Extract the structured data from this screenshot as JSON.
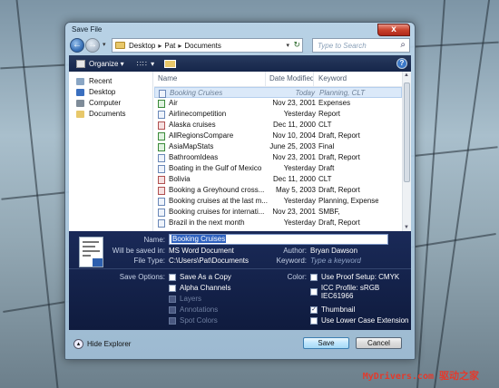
{
  "window": {
    "title": "Save File",
    "close_glyph": "x"
  },
  "nav": {
    "back_glyph": "←",
    "forward_glyph": "→",
    "dropdown_glyph": "▾",
    "breadcrumb": [
      "Desktop",
      "Pat",
      "Documents"
    ],
    "crumb_sep": "▸",
    "refresh_glyph": "↻",
    "search_placeholder": "Type to Search",
    "search_glyph": "⌕"
  },
  "toolbar": {
    "organize_label": "Organize ▾",
    "views_glyph": "∷∷ ▾",
    "help_glyph": "?"
  },
  "sidebar": {
    "items": [
      {
        "label": "Recent",
        "icon": "recent-icon",
        "color": "#8aa6c4"
      },
      {
        "label": "Desktop",
        "icon": "desktop-icon",
        "color": "#3a6fbf"
      },
      {
        "label": "Computer",
        "icon": "computer-icon",
        "color": "#7f8c99"
      },
      {
        "label": "Documents",
        "icon": "documents-folder-icon",
        "color": "#e8c86a"
      }
    ]
  },
  "files": {
    "columns": {
      "name": "Name",
      "date": "Date Modified",
      "keyword": "Keyword"
    },
    "rows": [
      {
        "name": "Booking Cruises",
        "date": "Today",
        "keyword": "Planning, CLT",
        "type": "doc",
        "selected": true
      },
      {
        "name": "Air",
        "date": "Nov 23, 2001",
        "keyword": "Expenses",
        "type": "xls"
      },
      {
        "name": "Airlinecompetition",
        "date": "Yesterday",
        "keyword": "Report",
        "type": "doc"
      },
      {
        "name": "Alaska cruises",
        "date": "Dec 11, 2000",
        "keyword": "CLT",
        "type": "jpg"
      },
      {
        "name": "AllRegionsCompare",
        "date": "Nov 10, 2004",
        "keyword": "Draft, Report",
        "type": "xls"
      },
      {
        "name": "AsiaMapStats",
        "date": "June 25, 2003",
        "keyword": "Final",
        "type": "xls"
      },
      {
        "name": "BathroomIdeas",
        "date": "Nov 23, 2001",
        "keyword": "Draft, Report",
        "type": "doc"
      },
      {
        "name": "Boating in the Gulf of Mexico",
        "date": "Yesterday",
        "keyword": "Draft",
        "type": "doc"
      },
      {
        "name": "Bolivia",
        "date": "Dec 11, 2000",
        "keyword": "CLT",
        "type": "jpg"
      },
      {
        "name": "Booking a Greyhound cross...",
        "date": "May 5, 2003",
        "keyword": "Draft, Report",
        "type": "jpg"
      },
      {
        "name": "Booking cruises at the last m...",
        "date": "Yesterday",
        "keyword": "Planning, Expenses...",
        "type": "doc"
      },
      {
        "name": "Booking cruises for internati...",
        "date": "Nov 23, 2001",
        "keyword": "SMBF,",
        "type": "doc"
      },
      {
        "name": "Brazil in the next month",
        "date": "Yesterday",
        "keyword": "Draft, Report",
        "type": "doc"
      }
    ]
  },
  "details": {
    "name_label": "Name:",
    "name_value": "Booking Cruises",
    "saved_in_label": "Will be saved in:",
    "saved_in_value": "MS Word Document",
    "filetype_label": "File Type:",
    "filetype_value": "C:\\Users\\Pat\\Documents",
    "author_label": "Author:",
    "author_value": "Bryan Dawson",
    "keyword_label": "Keyword:",
    "keyword_placeholder": "Type a keyword",
    "save_options_label": "Save Options:",
    "color_label": "Color:",
    "options_left": [
      {
        "label": "Save As a Copy",
        "checked": false,
        "enabled": true
      },
      {
        "label": "Alpha Channels",
        "checked": false,
        "enabled": true
      },
      {
        "label": "Layers",
        "checked": false,
        "enabled": false
      },
      {
        "label": "Annotations",
        "checked": false,
        "enabled": false
      },
      {
        "label": "Spot Colors",
        "checked": false,
        "enabled": false
      }
    ],
    "options_right": [
      {
        "label": "Use Proof Setup: CMYK",
        "checked": false
      },
      {
        "label": "ICC Profile: sRGB IEC61966",
        "checked": false
      },
      {
        "label": "Thumbnail",
        "checked": true
      },
      {
        "label": "Use Lower Case Extension",
        "checked": false
      }
    ],
    "check_glyph": "✓"
  },
  "footer": {
    "hide_explorer": "Hide Explorer",
    "hide_glyph": "▴",
    "save_label": "Save",
    "cancel_label": "Cancel"
  },
  "watermark": {
    "site": "MyDrivers.com",
    "cn": "驱动之家"
  }
}
